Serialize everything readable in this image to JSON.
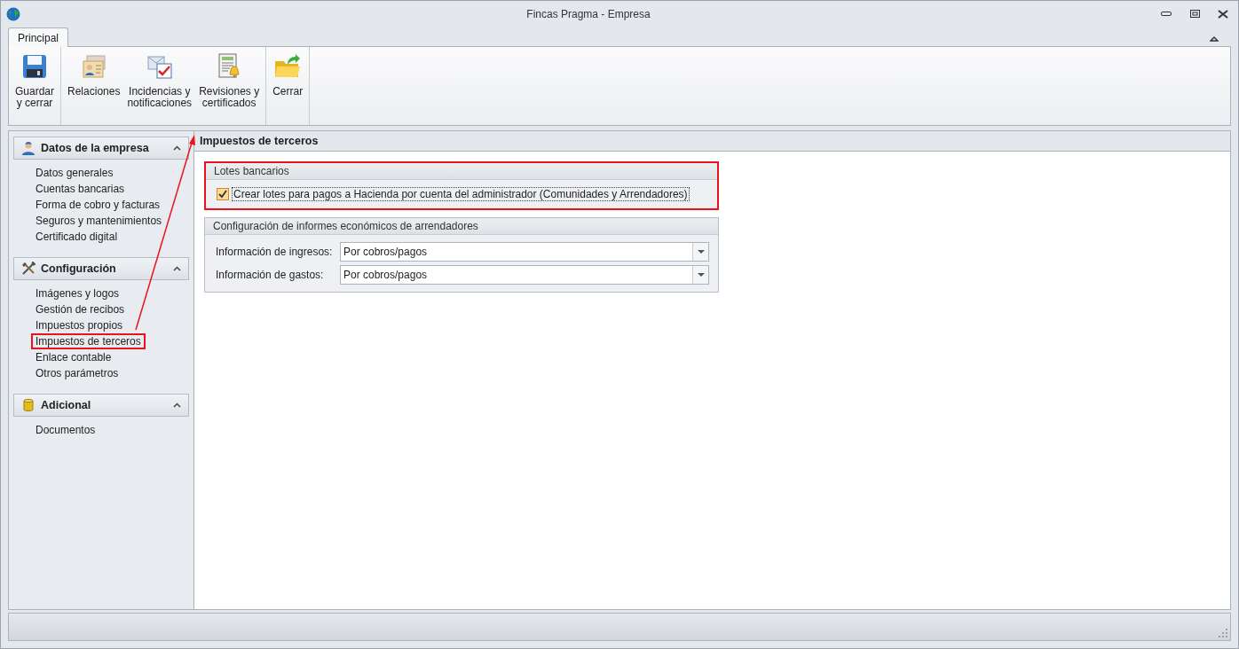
{
  "window": {
    "title": "Fincas Pragma - Empresa"
  },
  "ribbon": {
    "tabs": [
      {
        "label": "Principal",
        "selected": true
      }
    ],
    "groups": [
      {
        "buttons": [
          {
            "kind": "save",
            "lines": [
              "Guardar",
              "y cerrar"
            ]
          }
        ]
      },
      {
        "buttons": [
          {
            "kind": "contacts",
            "lines": [
              "Relaciones"
            ]
          },
          {
            "kind": "incidents",
            "lines": [
              "Incidencias y",
              "notificaciones"
            ]
          },
          {
            "kind": "reviews",
            "lines": [
              "Revisiones y",
              "certificados"
            ]
          }
        ]
      },
      {
        "buttons": [
          {
            "kind": "close",
            "lines": [
              "Cerrar"
            ]
          }
        ]
      }
    ]
  },
  "sidebar": {
    "sections": [
      {
        "title": "Datos de la empresa",
        "kind": "person",
        "expanded": true,
        "items": [
          {
            "label": "Datos generales",
            "highlighted": false
          },
          {
            "label": "Cuentas bancarias",
            "highlighted": false
          },
          {
            "label": "Forma de cobro y facturas",
            "highlighted": false
          },
          {
            "label": "Seguros y mantenimientos",
            "highlighted": false
          },
          {
            "label": "Certificado digital",
            "highlighted": false
          }
        ]
      },
      {
        "title": "Configuración",
        "kind": "tools",
        "expanded": true,
        "items": [
          {
            "label": "Imágenes y logos",
            "highlighted": false
          },
          {
            "label": "Gestión de recibos",
            "highlighted": false
          },
          {
            "label": "Impuestos propios",
            "highlighted": false
          },
          {
            "label": "Impuestos de terceros",
            "highlighted": true
          },
          {
            "label": "Enlace contable",
            "highlighted": false
          },
          {
            "label": "Otros parámetros",
            "highlighted": false
          }
        ]
      },
      {
        "title": "Adicional",
        "kind": "database",
        "expanded": true,
        "items": [
          {
            "label": "Documentos",
            "highlighted": false
          }
        ]
      }
    ]
  },
  "content": {
    "title": "Impuestos de terceros",
    "groups": [
      {
        "title": "Lotes bancarios",
        "kind": "checkbox",
        "highlighted": true,
        "checkbox": {
          "label": "Crear lotes para pagos a Hacienda por cuenta del administrador (Comunidades y Arrendadores)",
          "checked": true
        }
      },
      {
        "title": "Configuración de informes económicos de arrendadores",
        "kind": "fields",
        "highlighted": false,
        "fields": [
          {
            "label": "Información de ingresos:",
            "value": "Por cobros/pagos"
          },
          {
            "label": "Información de gastos:",
            "value": "Por cobros/pagos"
          }
        ]
      }
    ]
  }
}
